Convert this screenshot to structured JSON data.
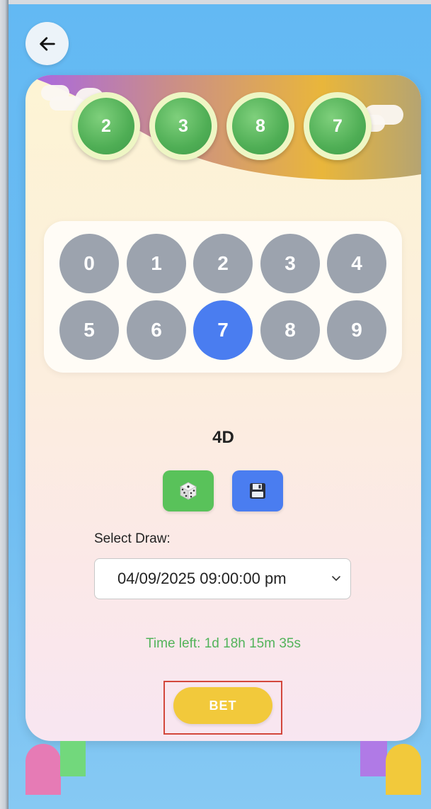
{
  "result_numbers": [
    "2",
    "3",
    "8",
    "7"
  ],
  "keypad": {
    "digits": [
      "0",
      "1",
      "2",
      "3",
      "4",
      "5",
      "6",
      "7",
      "8",
      "9"
    ],
    "selected": "7"
  },
  "mode_label": "4D",
  "icons": {
    "back": "arrow-left-icon",
    "random": "dice-icon",
    "save": "floppy-disk-icon",
    "dropdown": "chevron-down-icon"
  },
  "draw": {
    "label": "Select Draw:",
    "selected": "04/09/2025 09:00:00 pm"
  },
  "time_left": "Time left: 1d 18h 15m 35s",
  "bet_label": "BET",
  "colors": {
    "background": "#63b9f3",
    "ball_green": "#4fae55",
    "key_gray": "#9ca3ae",
    "key_selected": "#4a7df0",
    "dice_button": "#59c25a",
    "save_button": "#4a7df0",
    "bet_button": "#f2c93b",
    "time_left_text": "#52b35a",
    "highlight_border": "#d3473c"
  }
}
